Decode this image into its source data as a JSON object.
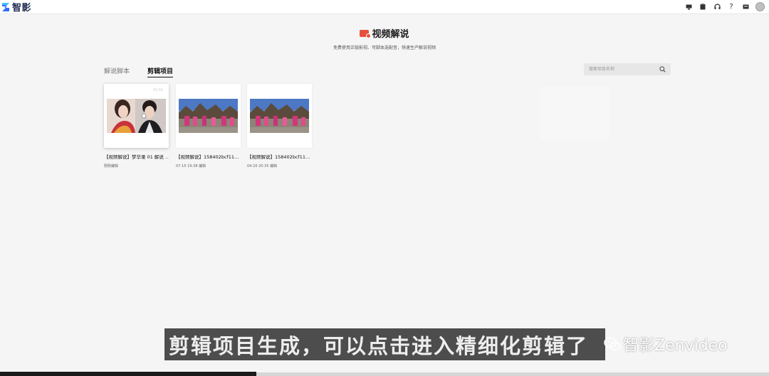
{
  "app": {
    "name": "智影"
  },
  "top_icons": [
    "display-icon",
    "clipboard-icon",
    "headset-icon",
    "help-icon",
    "message-icon",
    "avatar"
  ],
  "top_help_glyph": "?",
  "header": {
    "title": "视频解说",
    "subtitle": "免费使用正版影视、可脚本选配音，快速生产解说视频"
  },
  "tabs": [
    {
      "label": "解说脚本",
      "active": false
    },
    {
      "label": "剪辑项目",
      "active": true
    }
  ],
  "search": {
    "placeholder": "搜索项目名称"
  },
  "projects": [
    {
      "title": "【视频解说】梦华录 01 解说 ...",
      "meta": "刚刚编辑",
      "badge": "00:00"
    },
    {
      "title": "【视频解说】158402bcf11...",
      "meta": "07-15 19:38 编辑",
      "badge": ""
    },
    {
      "title": "【视频解说】158402bcf11...",
      "meta": "04-20 20:35 编辑",
      "badge": ""
    }
  ],
  "caption": {
    "text": "剪辑项目生成，可以点击进入精细化剪辑了"
  },
  "watermark": {
    "text": "智影Zenvideo"
  },
  "colors": {
    "accent": "#e8503e",
    "brand": "#1d2b4f",
    "background": "#f5f5f5"
  }
}
